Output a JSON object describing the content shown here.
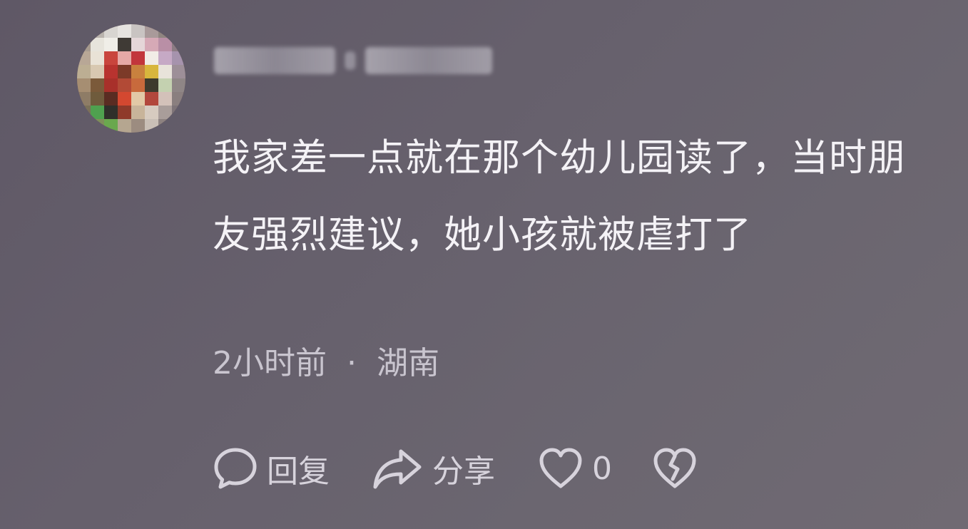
{
  "comment": {
    "username": "",
    "text": "我家差一点就在那个幼儿园读了，当时朋友强烈建议，她小孩就被虐打了",
    "time": "2小时前",
    "separator": "·",
    "location": "湖南"
  },
  "actions": {
    "reply_label": "回复",
    "share_label": "分享",
    "like_count": "0",
    "reply_icon": "speech-bubble-icon",
    "share_icon": "share-arrow-icon",
    "like_icon": "heart-icon",
    "dislike_icon": "broken-heart-icon"
  },
  "colors": {
    "text": "#f4f2f6",
    "meta": "#c9c5cf",
    "icon": "#d7d3dc"
  }
}
